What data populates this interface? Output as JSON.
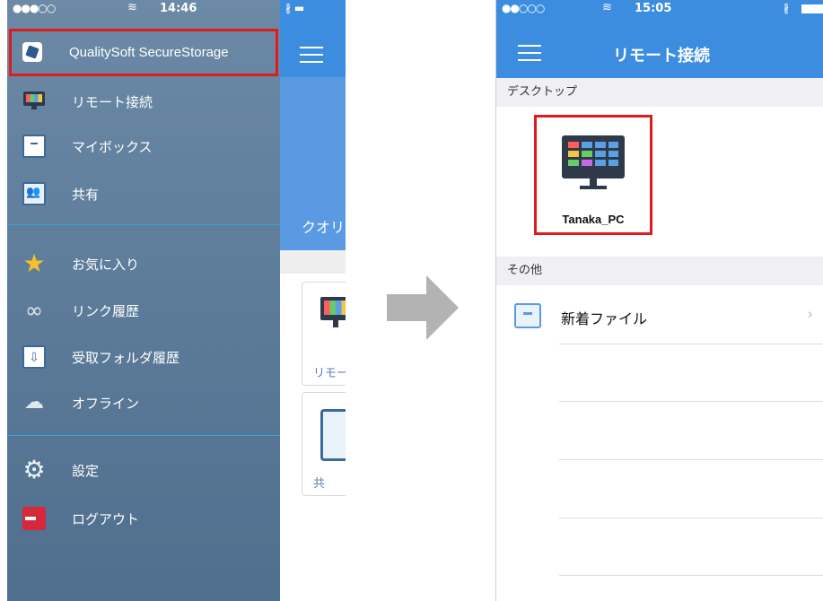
{
  "left_phone": {
    "status_bar": {
      "signal": "●●●○○",
      "wifi": "≋",
      "time": "14:46"
    },
    "drawer": {
      "app_name": "QualitySoft SecureStorage",
      "group1": [
        {
          "label": "リモート接続",
          "icon": "monitor-icon"
        },
        {
          "label": "マイボックス",
          "icon": "box-icon"
        },
        {
          "label": "共有",
          "icon": "share-icon"
        }
      ],
      "group2": [
        {
          "label": "お気に入り",
          "icon": "star-icon"
        },
        {
          "label": "リンク履歴",
          "icon": "link-icon"
        },
        {
          "label": "受取フォルダ履歴",
          "icon": "inbox-icon"
        },
        {
          "label": "オフライン",
          "icon": "cloud-icon"
        }
      ],
      "group3": [
        {
          "label": "設定",
          "icon": "gear-icon"
        },
        {
          "label": "ログアウト",
          "icon": "logout-icon"
        }
      ]
    },
    "background_app": {
      "status_right": "∦ ▬",
      "banner_text": "クオリ",
      "card1_caption": "リモー",
      "card2_caption": "共"
    }
  },
  "right_phone": {
    "status_bar": {
      "signal": "●●○○○",
      "wifi": "≋",
      "time": "15:05",
      "bluetooth": "∦"
    },
    "nav_title": "リモート接続",
    "section_desktop": "デスクトップ",
    "desktop_item": "Tanaka_PC",
    "section_other": "その他",
    "other_rows": [
      {
        "label": "新着ファイル",
        "chevron": "›"
      }
    ]
  },
  "colors": {
    "nav_blue": "#3c8de0",
    "drawer_slate": "#5b7a98",
    "highlight_red": "#e01b1b",
    "arrow_gray": "#b3b3b3"
  }
}
